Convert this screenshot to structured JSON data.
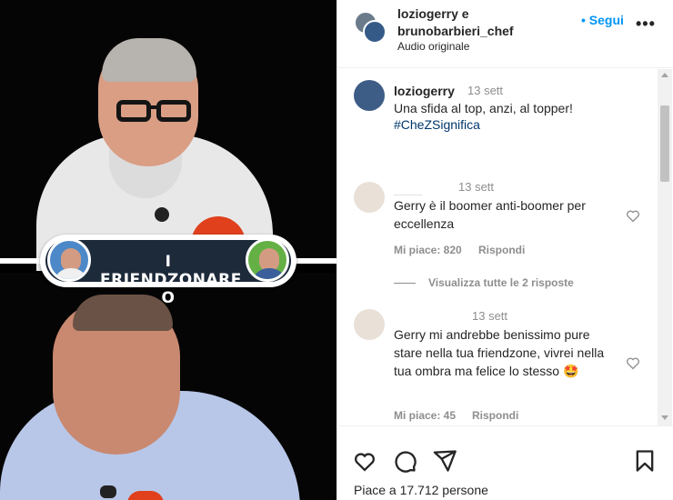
{
  "video": {
    "badge_text": "I FRIENDZONARE O"
  },
  "post": {
    "header_names": "loziogerry e\nbrunobarbieri_chef",
    "audio": "Audio originale",
    "follow_label": "• Segui",
    "more_label": "•••"
  },
  "caption": {
    "user": "loziogerry",
    "time": "13 sett",
    "text": "Una sfida al top, anzi, al topper!",
    "hashtag": "#CheZSignifica"
  },
  "comments": [
    {
      "user": "____",
      "time": "13 sett",
      "text": "Gerry è il boomer anti-boomer per eccellenza",
      "likes": "Mi piace: 820",
      "reply": "Rispondi"
    },
    {
      "user": "",
      "time": "13 sett",
      "text": "Gerry mi andrebbe benissimo pure stare nella tua friendzone, vivrei nella tua ombra ma felice lo stesso 🤩",
      "likes": "Mi piace: 45",
      "reply": "Rispondi"
    }
  ],
  "replies_link": "Visualizza tutte le 2 risposte",
  "likes_total": "Piace a 17.712 persone",
  "icons": [
    "heart-icon",
    "comment-icon",
    "share-icon",
    "bookmark-icon",
    "more-icon"
  ],
  "colors": {
    "link_blue": "#0095f6",
    "hashtag": "#00376b",
    "muted": "#8e8e8e"
  }
}
